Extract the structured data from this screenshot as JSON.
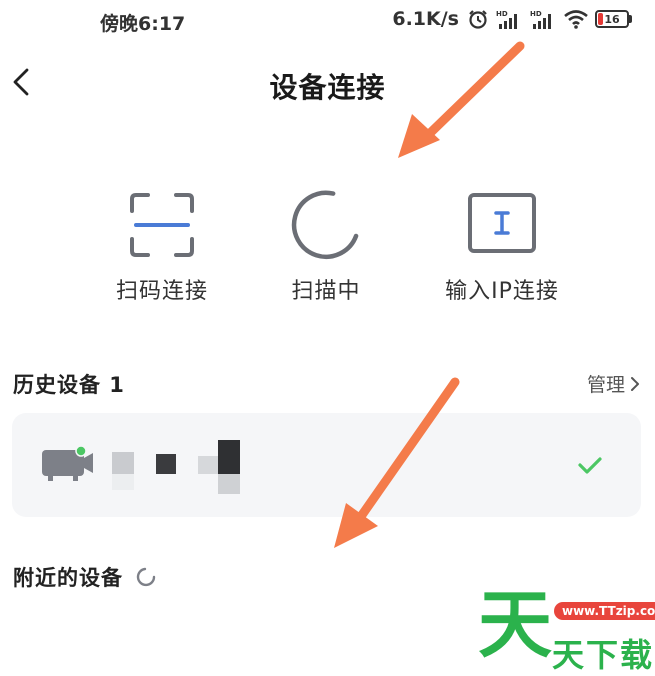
{
  "status_bar": {
    "time": "傍晚6:17",
    "net_speed": "6.1K/s",
    "battery": "16",
    "icons": [
      "alarm-icon",
      "hd-signal-icon",
      "hd-signal-icon",
      "wifi-icon",
      "battery-icon"
    ]
  },
  "header": {
    "title": "设备连接",
    "back_icon": "chevron-left-icon"
  },
  "actions": [
    {
      "label": "扫码连接",
      "icon": "scan-frame-icon"
    },
    {
      "label": "扫描中",
      "icon": "loading-ring-icon"
    },
    {
      "label": "输入IP连接",
      "icon": "ip-input-icon"
    }
  ],
  "history": {
    "title": "历史设备 1",
    "manage_label": "管理"
  },
  "nearby": {
    "title": "附近的设备"
  },
  "watermark": {
    "mark": "天",
    "url": "www.TTzip.com",
    "sub": "天下载"
  },
  "colors": {
    "accent_blue": "#4a7bd6",
    "icon_gray": "#6b6e75",
    "check_green": "#4cc764",
    "arrow_orange": "#f47b4a",
    "watermark_green": "#2bb24c",
    "watermark_red": "#e8453c"
  }
}
